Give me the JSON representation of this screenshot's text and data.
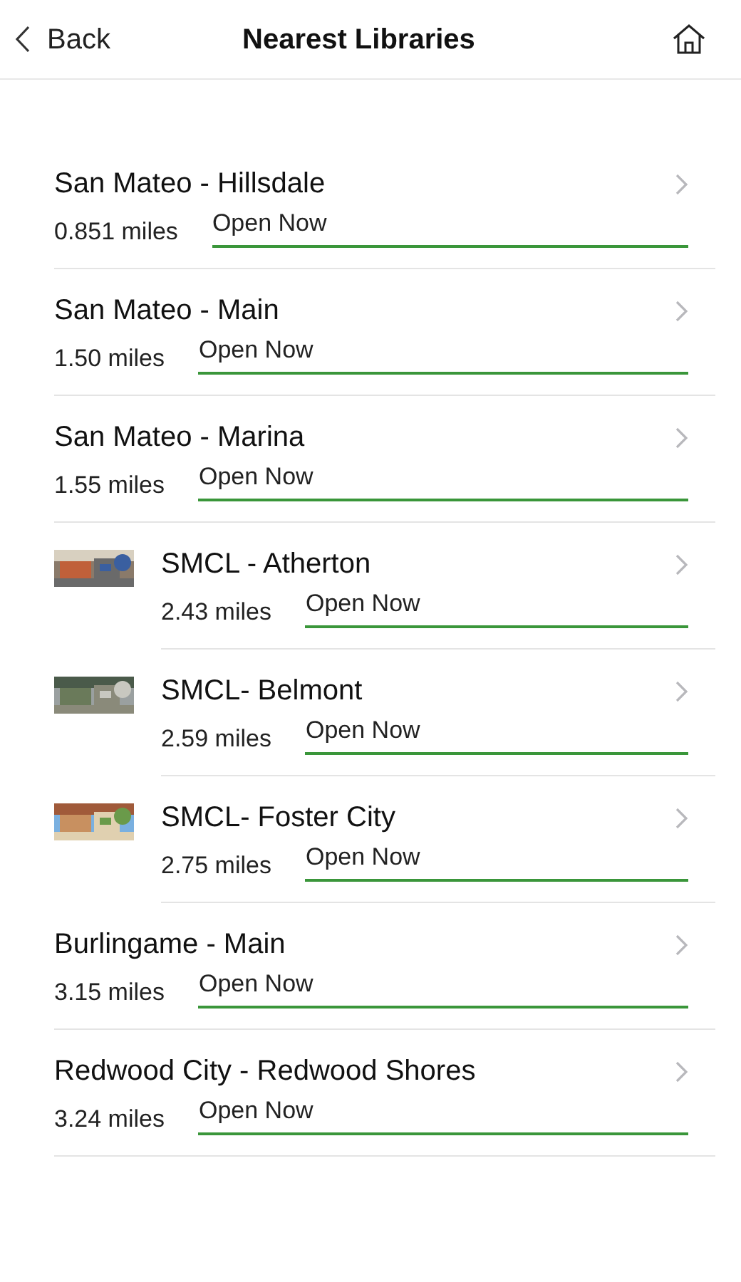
{
  "header": {
    "back": "Back",
    "title": "Nearest Libraries"
  },
  "libraries": [
    {
      "kind": "plain",
      "name": "San Mateo - Hillsdale",
      "distance": "0.851 miles",
      "status": "Open Now"
    },
    {
      "kind": "plain",
      "name": "San Mateo - Main",
      "distance": "1.50 miles",
      "status": "Open Now"
    },
    {
      "kind": "plain",
      "name": "San Mateo - Marina",
      "distance": "1.55 miles",
      "status": "Open Now"
    },
    {
      "name": "SMCL - Atherton",
      "distance": "2.43 miles",
      "status": "Open Now"
    },
    {
      "name": "SMCL- Belmont",
      "distance": "2.59 miles",
      "status": "Open Now"
    },
    {
      "name": "SMCL- Foster City",
      "distance": "2.75 miles",
      "status": "Open Now"
    },
    {
      "kind": "plain",
      "name": "Burlingame - Main",
      "distance": "3.15 miles",
      "status": "Open Now"
    },
    {
      "kind": "plain",
      "name": "Redwood City - Redwood Shores",
      "distance": "3.24 miles",
      "status": "Open Now"
    }
  ]
}
